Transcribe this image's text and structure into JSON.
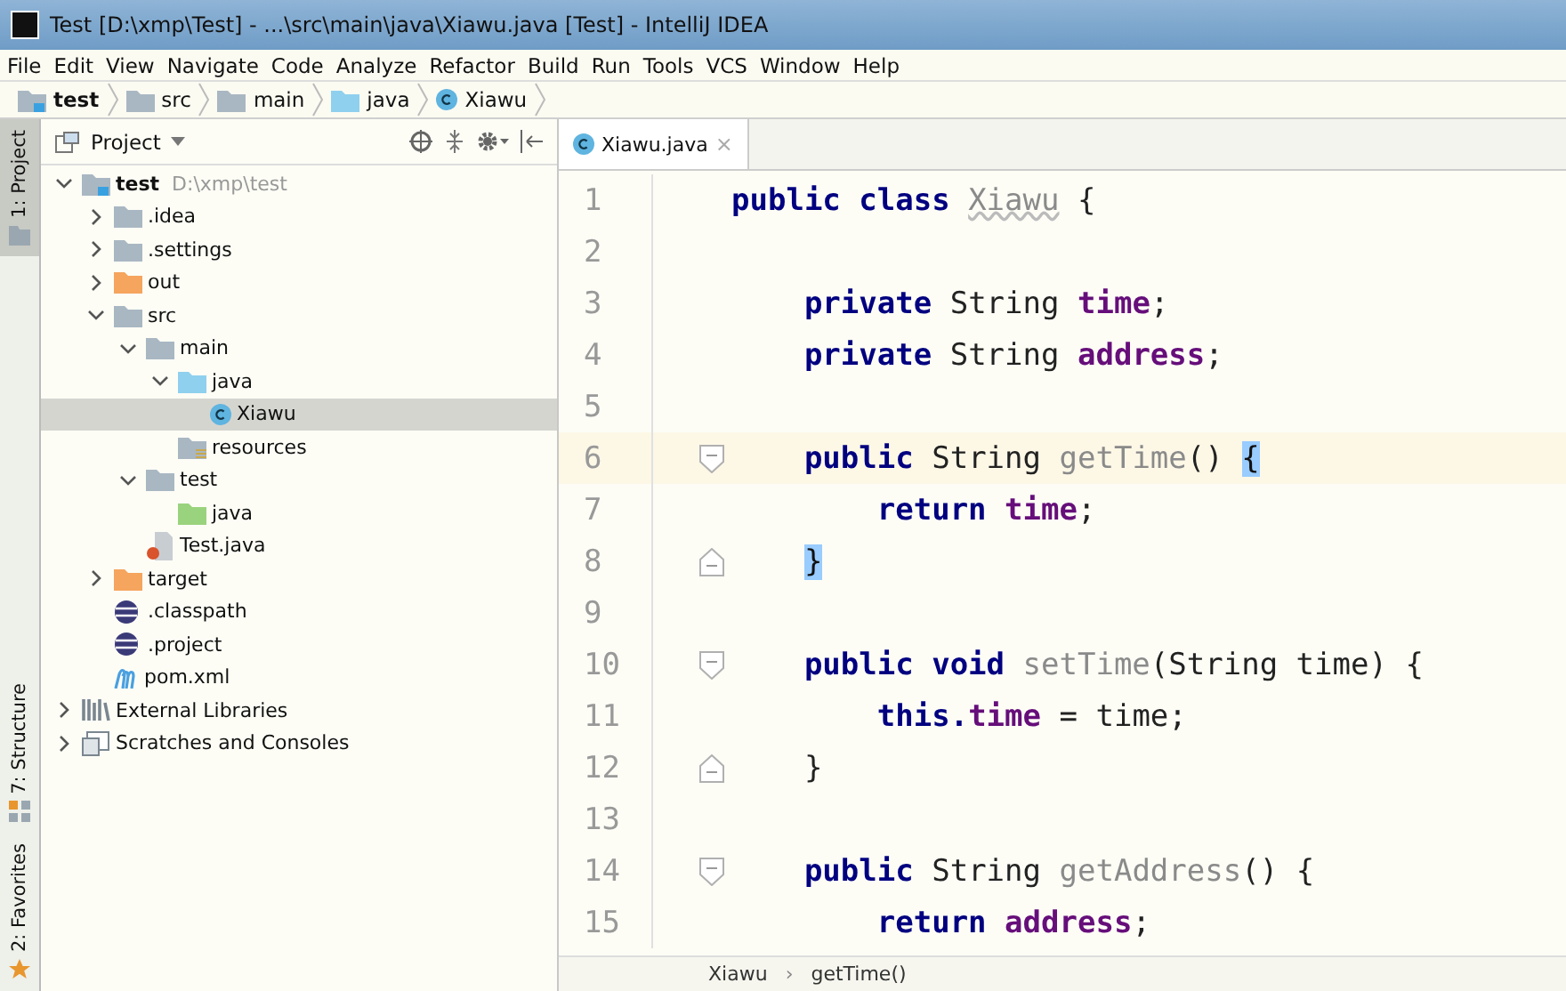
{
  "window": {
    "title": "Test [D:\\xmp\\Test] - ...\\src\\main\\java\\Xiawu.java [Test] - IntelliJ IDEA"
  },
  "menu": [
    "File",
    "Edit",
    "View",
    "Navigate",
    "Code",
    "Analyze",
    "Refactor",
    "Build",
    "Run",
    "Tools",
    "VCS",
    "Window",
    "Help"
  ],
  "nav_bar": [
    {
      "label": "test",
      "kind": "module"
    },
    {
      "label": "src",
      "kind": "folder"
    },
    {
      "label": "main",
      "kind": "folder"
    },
    {
      "label": "java",
      "kind": "source"
    },
    {
      "label": "Xiawu",
      "kind": "class"
    }
  ],
  "side_stripe": [
    {
      "label": "1: Project",
      "selected": true
    },
    {
      "label": "7: Structure",
      "selected": false
    },
    {
      "label": "2: Favorites",
      "selected": false
    }
  ],
  "project_panel": {
    "title": "Project",
    "tree": [
      {
        "label": "test",
        "hint": "D:\\xmp\\test",
        "kind": "module",
        "expanded": true,
        "selected": false,
        "children": [
          {
            "label": ".idea",
            "kind": "folder",
            "expanded": false,
            "selected": false
          },
          {
            "label": ".settings",
            "kind": "folder",
            "expanded": false,
            "selected": false
          },
          {
            "label": "out",
            "kind": "excluded",
            "expanded": false,
            "selected": false
          },
          {
            "label": "src",
            "kind": "folder",
            "expanded": true,
            "selected": false,
            "children": [
              {
                "label": "main",
                "kind": "folder",
                "expanded": true,
                "selected": false,
                "children": [
                  {
                    "label": "java",
                    "kind": "source",
                    "expanded": true,
                    "selected": false,
                    "children": [
                      {
                        "label": "Xiawu",
                        "kind": "class",
                        "selected": true
                      }
                    ]
                  },
                  {
                    "label": "resources",
                    "kind": "resources",
                    "selected": false
                  }
                ]
              },
              {
                "label": "test",
                "kind": "folder",
                "expanded": true,
                "selected": false,
                "children": [
                  {
                    "label": "java",
                    "kind": "test-source",
                    "selected": false
                  }
                ]
              },
              {
                "label": "Test.java",
                "kind": "java-file",
                "selected": false
              }
            ]
          },
          {
            "label": "target",
            "kind": "excluded",
            "expanded": false,
            "selected": false
          },
          {
            "label": ".classpath",
            "kind": "eclipse",
            "selected": false
          },
          {
            "label": ".project",
            "kind": "eclipse",
            "selected": false
          },
          {
            "label": "pom.xml",
            "kind": "maven",
            "selected": false
          }
        ]
      },
      {
        "label": "External Libraries",
        "kind": "libraries",
        "expanded": false,
        "selected": false
      },
      {
        "label": "Scratches and Consoles",
        "kind": "scratches",
        "expanded": false,
        "selected": false
      }
    ]
  },
  "editor": {
    "tabs": [
      {
        "label": "Xiawu.java",
        "selected": true,
        "close": "×"
      }
    ],
    "lines": [
      {
        "number": "1",
        "current": false,
        "kind": "code",
        "tokens": [
          {
            "text": "public class ",
            "kind": "keyword"
          },
          {
            "text": "Xiawu",
            "kind": "unused-class"
          },
          {
            "text": " {",
            "kind": "plain"
          }
        ]
      },
      {
        "number": "2",
        "current": false,
        "kind": "code"
      },
      {
        "number": "3",
        "current": false,
        "kind": "code",
        "tokens": [
          {
            "text": "private ",
            "kind": "keyword"
          },
          {
            "text": "String ",
            "kind": "plain"
          },
          {
            "text": "time",
            "kind": "field"
          },
          {
            "text": ";",
            "kind": "plain"
          }
        ]
      },
      {
        "number": "4",
        "current": false,
        "kind": "code",
        "tokens": [
          {
            "text": "private ",
            "kind": "keyword"
          },
          {
            "text": "String ",
            "kind": "plain"
          },
          {
            "text": "address",
            "kind": "field"
          },
          {
            "text": ";",
            "kind": "plain"
          }
        ]
      },
      {
        "number": "5",
        "current": false,
        "kind": "code"
      },
      {
        "number": "6",
        "current": true,
        "kind": "fold-start",
        "tokens": [
          {
            "text": "public ",
            "kind": "keyword"
          },
          {
            "text": "String ",
            "kind": "plain"
          },
          {
            "text": "getTime",
            "kind": "unused"
          },
          {
            "text": "() ",
            "kind": "plain"
          },
          {
            "text": "{",
            "kind": "brace-match"
          }
        ]
      },
      {
        "number": "7",
        "current": false,
        "kind": "code",
        "tokens": [
          {
            "text": "return ",
            "kind": "keyword"
          },
          {
            "text": "time",
            "kind": "field"
          },
          {
            "text": ";",
            "kind": "plain"
          }
        ]
      },
      {
        "number": "8",
        "current": false,
        "kind": "fold-end",
        "tokens": [
          {
            "text": "}",
            "kind": "brace-match"
          }
        ]
      },
      {
        "number": "9",
        "current": false,
        "kind": "code"
      },
      {
        "number": "10",
        "current": false,
        "kind": "fold-start",
        "tokens": [
          {
            "text": "public void ",
            "kind": "keyword"
          },
          {
            "text": "setTime",
            "kind": "unused"
          },
          {
            "text": "(String time) {",
            "kind": "plain"
          }
        ]
      },
      {
        "number": "11",
        "current": false,
        "kind": "code",
        "tokens": [
          {
            "text": "this.",
            "kind": "keyword"
          },
          {
            "text": "time",
            "kind": "field"
          },
          {
            "text": " = time;",
            "kind": "plain"
          }
        ]
      },
      {
        "number": "12",
        "current": false,
        "kind": "fold-end",
        "tokens": [
          {
            "text": "}",
            "kind": "plain"
          }
        ]
      },
      {
        "number": "13",
        "current": false,
        "kind": "code"
      },
      {
        "number": "14",
        "current": false,
        "kind": "fold-start",
        "tokens": [
          {
            "text": "public ",
            "kind": "keyword"
          },
          {
            "text": "String ",
            "kind": "plain"
          },
          {
            "text": "getAddress",
            "kind": "unused"
          },
          {
            "text": "() {",
            "kind": "plain"
          }
        ]
      },
      {
        "number": "15",
        "current": false,
        "kind": "code",
        "tokens": [
          {
            "text": "return ",
            "kind": "keyword"
          },
          {
            "text": "address",
            "kind": "field"
          },
          {
            "text": ";",
            "kind": "plain"
          }
        ]
      }
    ],
    "breadcrumbs": [
      "Xiawu",
      "›",
      "getTime()"
    ]
  }
}
